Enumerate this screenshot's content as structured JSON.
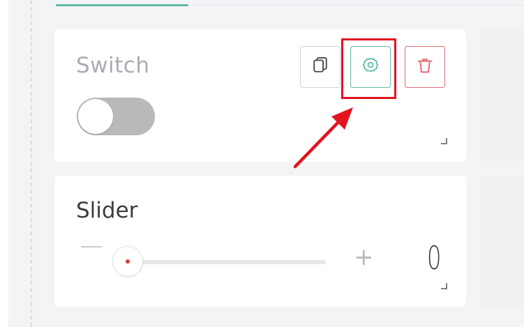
{
  "switch_widget": {
    "label": "Switch",
    "toggle_state": "off"
  },
  "toolbar": {
    "copy_icon": "copy-icon",
    "settings_icon": "gear-icon",
    "delete_icon": "trash-icon"
  },
  "slider_widget": {
    "label": "Slider",
    "minus_symbol": "—",
    "plus_symbol": "+",
    "value": "0"
  },
  "colors": {
    "accent": "#5db9a6",
    "danger": "#e06c75",
    "highlight": "#e1141f"
  }
}
